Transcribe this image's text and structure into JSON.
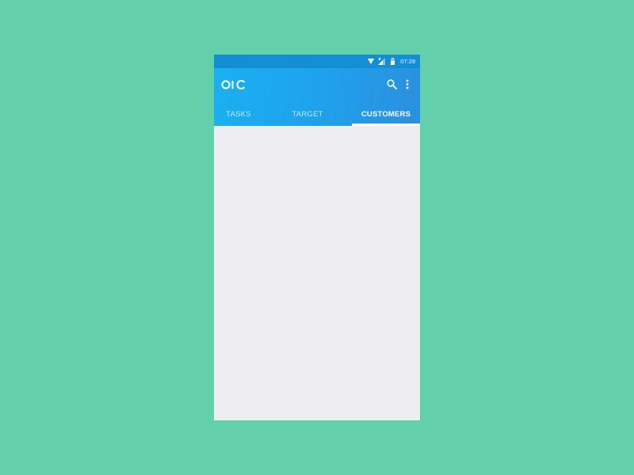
{
  "status_bar": {
    "time": "07:28",
    "icons": [
      "wifi-icon",
      "signal-icon",
      "battery-icon"
    ]
  },
  "app_bar": {
    "logo_text": "OIC",
    "actions": [
      {
        "name": "search",
        "icon": "search-icon"
      },
      {
        "name": "more",
        "icon": "more-vert-icon"
      }
    ]
  },
  "tabs": [
    {
      "label": "TASKS",
      "active": false
    },
    {
      "label": "TARGET",
      "active": false
    },
    {
      "label": "CUSTOMERS",
      "active": true
    }
  ],
  "content": {
    "items": []
  },
  "colors": {
    "background": "#63D0AB",
    "status_bar": "#158FD4",
    "app_bar_start": "#1AB0F2",
    "app_bar_end": "#2B8FDF",
    "content_bg": "#EEEDF1",
    "tab_indicator": "#FFFFFF"
  }
}
